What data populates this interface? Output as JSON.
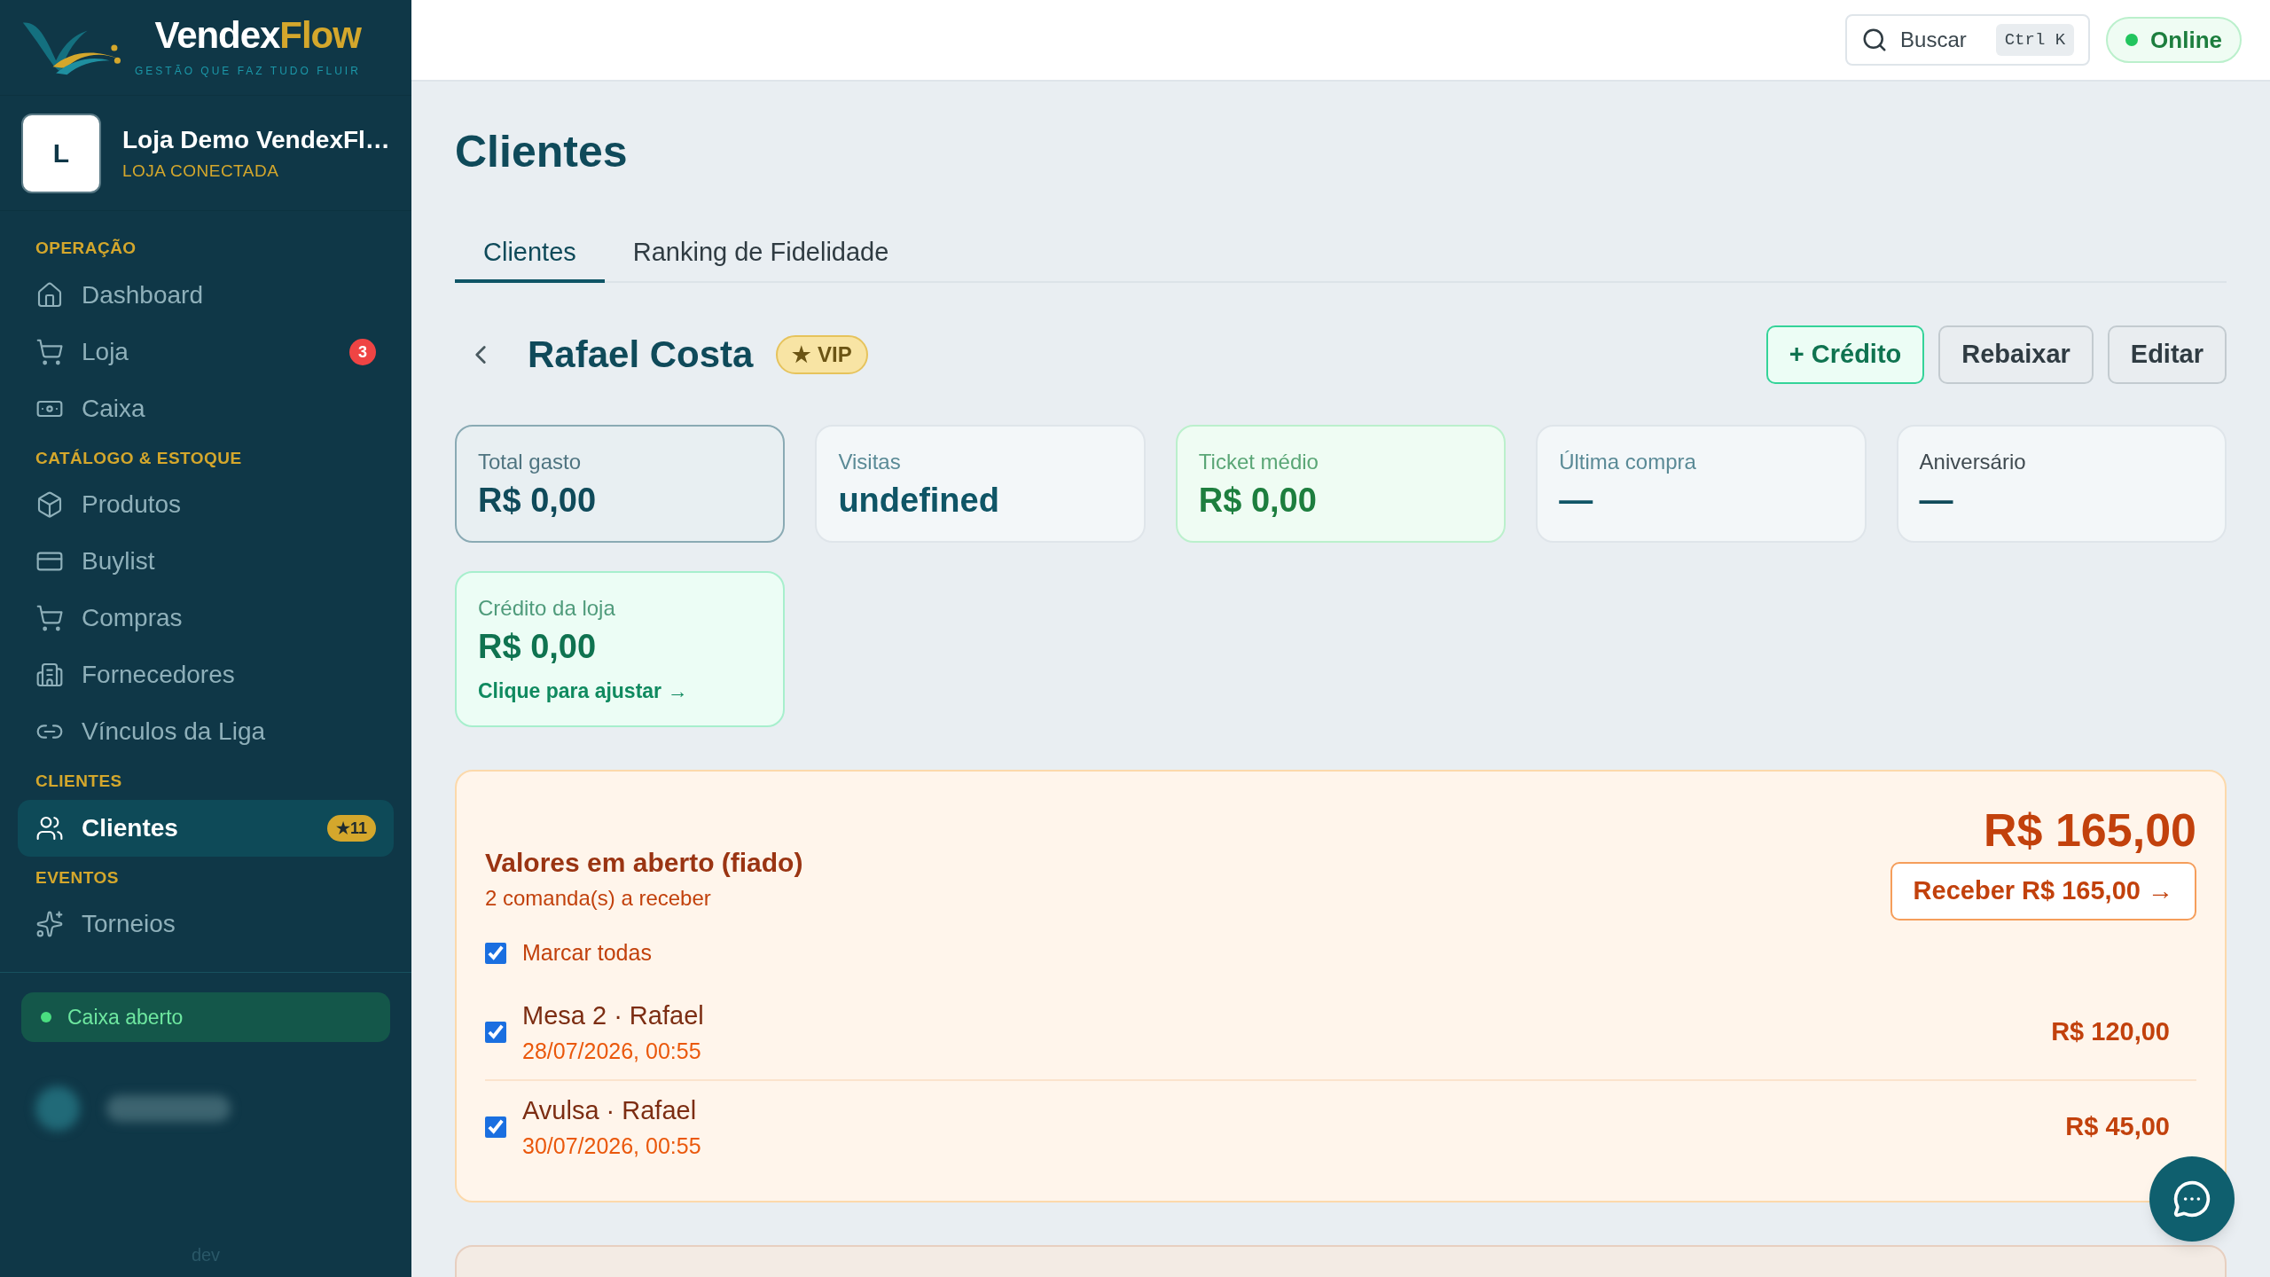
{
  "brand": {
    "name_main": "Vendex",
    "name_accent": "Flow",
    "tagline": "GESTÃO QUE FAZ TUDO FLUIR"
  },
  "store": {
    "initial": "L",
    "name": "Loja Demo VendexFl…",
    "status": "LOJA CONECTADA"
  },
  "nav": [
    {
      "heading": "OPERAÇÃO",
      "items": [
        {
          "label": "Dashboard",
          "selected": false
        },
        {
          "label": "Loja",
          "selected": false,
          "badge": {
            "text": "3",
            "color": "#ef4444"
          }
        },
        {
          "label": "Caixa",
          "selected": false
        }
      ]
    },
    {
      "heading": "CATÁLOGO & ESTOQUE",
      "items": [
        {
          "label": "Produtos",
          "selected": false
        },
        {
          "label": "Buylist",
          "selected": false
        },
        {
          "label": "Compras",
          "selected": false
        },
        {
          "label": "Fornecedores",
          "selected": false
        },
        {
          "label": "Vínculos da Liga",
          "selected": false
        }
      ]
    },
    {
      "heading": "CLIENTES",
      "items": [
        {
          "label": "Clientes",
          "selected": true,
          "badge": {
            "text": "★11",
            "color": "#d4a72c"
          }
        }
      ]
    },
    {
      "heading": "EVENTOS",
      "items": [
        {
          "label": "Torneios",
          "selected": false
        }
      ]
    }
  ],
  "register": {
    "label": "Caixa aberto",
    "open": true
  },
  "footer": "dev",
  "topbar": {
    "search": {
      "placeholder": "Buscar",
      "shortcut": "Ctrl K"
    },
    "connection": {
      "label": "Online",
      "online": true
    }
  },
  "page_title": "Clientes",
  "tabs": [
    {
      "label": "Clientes",
      "selected": true
    },
    {
      "label": "Ranking de Fidelidade",
      "selected": false
    }
  ],
  "customer": {
    "name": "Rafael Costa",
    "badge": "★ VIP"
  },
  "actions": [
    {
      "label": "+ Crédito",
      "kind": "accent"
    },
    {
      "label": "Rebaixar",
      "kind": "plain"
    },
    {
      "label": "Editar",
      "kind": "plain"
    }
  ],
  "stats": [
    {
      "label": "Total gasto",
      "value": "R$ 0,00",
      "kind": "highlight"
    },
    {
      "label": "Visitas",
      "value": "undefined",
      "kind": "plain"
    },
    {
      "label": "Ticket médio",
      "value": "R$ 0,00",
      "kind": "success"
    },
    {
      "label": "Última compra",
      "value": "—",
      "kind": "plain"
    },
    {
      "label": "Aniversário",
      "value": "—",
      "kind": "neutral"
    },
    {
      "label": "Crédito da loja",
      "value": "R$ 0,00",
      "link": "Clique para ajustar →",
      "kind": "credit"
    }
  ],
  "open_balance": {
    "title": "Valores em aberto (fiado)",
    "subtitle": "2 comanda(s) a receber",
    "total": "R$ 165,00",
    "receive_button": "Receber R$ 165,00 →",
    "select_all": {
      "label": "Marcar todas",
      "checked": true
    },
    "items": [
      {
        "name": "Mesa 2 · Rafael",
        "date": "28/07/2026, 00:55",
        "amount": "R$ 120,00",
        "checked": true
      },
      {
        "name": "Avulsa · Rafael",
        "date": "30/07/2026, 00:55",
        "amount": "R$ 45,00",
        "checked": true
      }
    ]
  }
}
